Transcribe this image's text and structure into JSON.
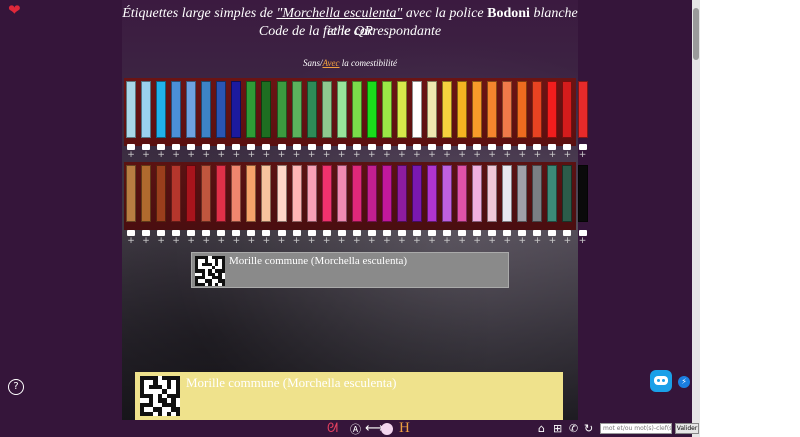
{
  "header": {
    "title_line1_pre": "Étiquettes large simples de ",
    "title_species": "\"Morchella esculenta\"",
    "title_line1_mid": " avec la police ",
    "title_font": "Bodoni",
    "title_line1_post": " blanche et le QR",
    "title_line2": "Code de la fiche correspondante"
  },
  "toggle": {
    "sans": "Sans",
    "sep": "/",
    "avec": "Avec",
    "rest": " la comestibilité"
  },
  "swatches": {
    "row1": [
      "#a9d7e8",
      "#9ad1ee",
      "#21b1ea",
      "#4b8fd8",
      "#6fa2e0",
      "#3d83c6",
      "#2a55b3",
      "#1c1a9e",
      "#2f9c36",
      "#1e6e21",
      "#3c9a3f",
      "#5cb35d",
      "#2e8b57",
      "#8fc98f",
      "#98e49a",
      "#7bdc4a",
      "#1bdc1b",
      "#9be846",
      "#d7e84a",
      "#ffffff",
      "#f0e7b0",
      "#f6d23e",
      "#f5b321",
      "#f89b2a",
      "#f5852d",
      "#f07a4a",
      "#ef6b1f",
      "#e84322",
      "#f21d1d",
      "#d41c1c",
      "#e62a2a"
    ],
    "row2": [
      "#b87d42",
      "#b06a2e",
      "#9a3e1c",
      "#b5362c",
      "#a8141c",
      "#c0563e",
      "#e03048",
      "#f0866e",
      "#f6a36a",
      "#f7c39e",
      "#ffd6c8",
      "#ffb5b5",
      "#f8a0b6",
      "#f0326e",
      "#f08ab2",
      "#e0287a",
      "#c21f90",
      "#c2189c",
      "#8d1ca0",
      "#7a18b0",
      "#b034d0",
      "#c060e0",
      "#e052a8",
      "#f0b0e0",
      "#f0c8d8",
      "#e8e8f0",
      "#a0a0a8",
      "#7a7f84",
      "#3c8a78",
      "#2c5c4a",
      "#0a0a0a"
    ]
  },
  "labels": {
    "small_text": "Morille commune (Morchella esculenta)",
    "big_text": "Morille commune (Morchella esculenta)"
  },
  "bottom": {
    "search_placeholder": "mot et/ou mot(s)-clef(s)",
    "validate_label": "Valider"
  },
  "icons": {
    "heart": "heart-icon",
    "help": "help-icon",
    "bot": "robot-assistant-icon",
    "bolt": "lightning-icon",
    "home": "home-icon",
    "sitemap": "sitemap-icon",
    "phone": "phone-icon",
    "refresh": "refresh-icon"
  },
  "colors": {
    "accent_orange": "#f1a040",
    "label_yellow": "#efe28c",
    "label_gray": "#8a8a8a"
  }
}
